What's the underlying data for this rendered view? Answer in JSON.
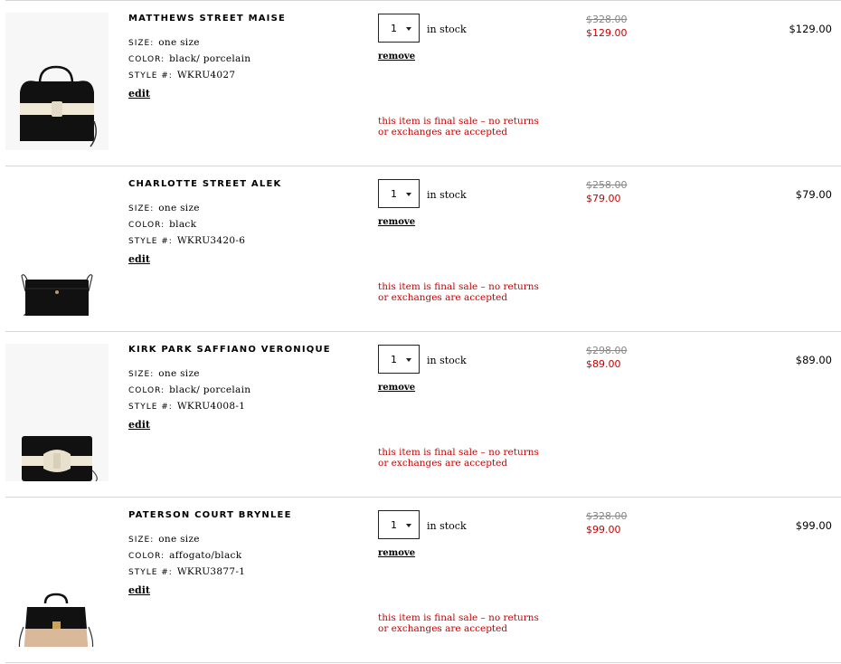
{
  "labels": {
    "size_key": "SIZE:",
    "color_key": "COLOR:",
    "style_key": "STYLE #:",
    "edit": "edit",
    "remove": "remove",
    "in_stock": "in stock",
    "final_sale": "this item is final sale – no returns or exchanges are accepted"
  },
  "colors": {
    "sale_red": "#cc0000",
    "strike_gray": "#888888",
    "divider": "#d6d6d6"
  },
  "items": [
    {
      "name": "MATTHEWS STREET MAISE",
      "size": "one size",
      "color": "black/ porcelain",
      "style": "WKRU4027",
      "qty": "1",
      "original_price": "$328.00",
      "sale_price": "$129.00",
      "total": "$129.00",
      "image": "satchel-bow-bag"
    },
    {
      "name": "CHARLOTTE STREET ALEK",
      "size": "one size",
      "color": "black",
      "style": "WKRU3420-6",
      "qty": "1",
      "original_price": "$258.00",
      "sale_price": "$79.00",
      "total": "$79.00",
      "image": "crossbody-wallet-bag"
    },
    {
      "name": "KIRK PARK SAFFIANO VERONIQUE",
      "size": "one size",
      "color": "black/ porcelain",
      "style": "WKRU4008-1",
      "qty": "1",
      "original_price": "$298.00",
      "sale_price": "$89.00",
      "total": "$89.00",
      "image": "bow-crossbody-bag"
    },
    {
      "name": "PATERSON COURT BRYNLEE",
      "size": "one size",
      "color": "affogato/black",
      "style": "WKRU3877-1",
      "qty": "1",
      "original_price": "$328.00",
      "sale_price": "$99.00",
      "total": "$99.00",
      "image": "two-tone-satchel"
    }
  ]
}
